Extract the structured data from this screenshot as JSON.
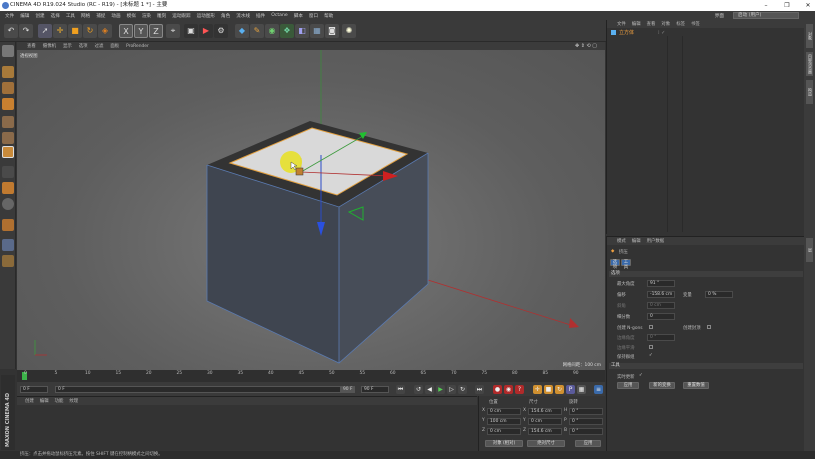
{
  "window": {
    "title": "CINEMA 4D R19.024 Studio (RC - R19) - [未标题 1 *] - 主要",
    "minimize": "–",
    "maximize": "❐",
    "close": "✕"
  },
  "menubar": {
    "items": [
      "文件",
      "编辑",
      "创建",
      "选择",
      "工具",
      "网格",
      "捕捉",
      "动画",
      "模拟",
      "渲染",
      "雕刻",
      "运动跟踪",
      "运动图形",
      "角色",
      "流水线",
      "插件",
      "Octane",
      "脚本",
      "窗口",
      "帮助"
    ],
    "layout_label": "界面",
    "layout_value": "启动 (用户)"
  },
  "toolbar": {
    "undo": "↶",
    "redo": "↷",
    "axis_x": "X",
    "axis_y": "Y",
    "axis_z": "Z"
  },
  "viewport": {
    "menu": [
      "查看",
      "摄像机",
      "显示",
      "选项",
      "过滤",
      "面板",
      "ProRender"
    ],
    "label": "透视视图",
    "grid_info": "网格间距：100 cm"
  },
  "timeline": {
    "ticks": [
      "0",
      "5",
      "10",
      "15",
      "20",
      "25",
      "30",
      "35",
      "40",
      "45",
      "50",
      "55",
      "60",
      "65",
      "70",
      "75",
      "80",
      "85",
      "90"
    ],
    "current_frame": "0 F",
    "start_frame": "0 F",
    "end_frame": "90 F",
    "max_frame": "90 F"
  },
  "materials": {
    "menu": [
      "创建",
      "编辑",
      "功能",
      "纹理"
    ]
  },
  "coords": {
    "headers": [
      "位置",
      "尺寸",
      "旋转"
    ],
    "rows": [
      {
        "axis": "X",
        "pos": "0 cm",
        "size": "154.6 cm",
        "rot_label": "H",
        "rot": "0 °"
      },
      {
        "axis": "Y",
        "pos": "100 cm",
        "size": "0 cm",
        "rot_label": "P",
        "rot": "0 °"
      },
      {
        "axis": "Z",
        "pos": "0 cm",
        "size": "154.6 cm",
        "rot_label": "B",
        "rot": "0 °"
      }
    ],
    "mode": "对象 (相对)",
    "size_mode": "绝对尺寸",
    "apply": "应用"
  },
  "objects": {
    "menu": [
      "文件",
      "编辑",
      "查看",
      "对象",
      "标签",
      "书签"
    ],
    "item_name": "立方体"
  },
  "attributes": {
    "menu": [
      "模式",
      "编辑",
      "用户数据"
    ],
    "tool_name": "挤压",
    "tabs": [
      "选项",
      "工具"
    ],
    "section_options": "选项",
    "max_angle_label": "最大角度",
    "max_angle": "91 °",
    "offset_label": "偏移",
    "offset": "-158.6 cm",
    "variance_label": "变量",
    "variance": "0 %",
    "bevel_label": "斜角",
    "bevel": "0 cm",
    "subdiv_label": "细分数",
    "subdiv": "0",
    "create_ngons": "创建 N-gons",
    "create_caps": "创建封顶",
    "edge_angle": "边缘角度",
    "edge_angle_val": "0 °",
    "edge_smooth": "边缘平滑",
    "preserve_groups": "保持群组",
    "section_tool": "工具",
    "realtime_update": "实时更新",
    "apply": "应用",
    "new_transform": "新的变换",
    "reset_values": "重置数值"
  },
  "rightstrip": [
    "对象",
    "内容浏览器",
    "构造",
    "层"
  ],
  "statusbar": "挤压：点击并拖动鼠标挤压元素。按住 SHIFT 键在控制柄模式之间切换。",
  "brand": "MAXON CINEMA 4D"
}
